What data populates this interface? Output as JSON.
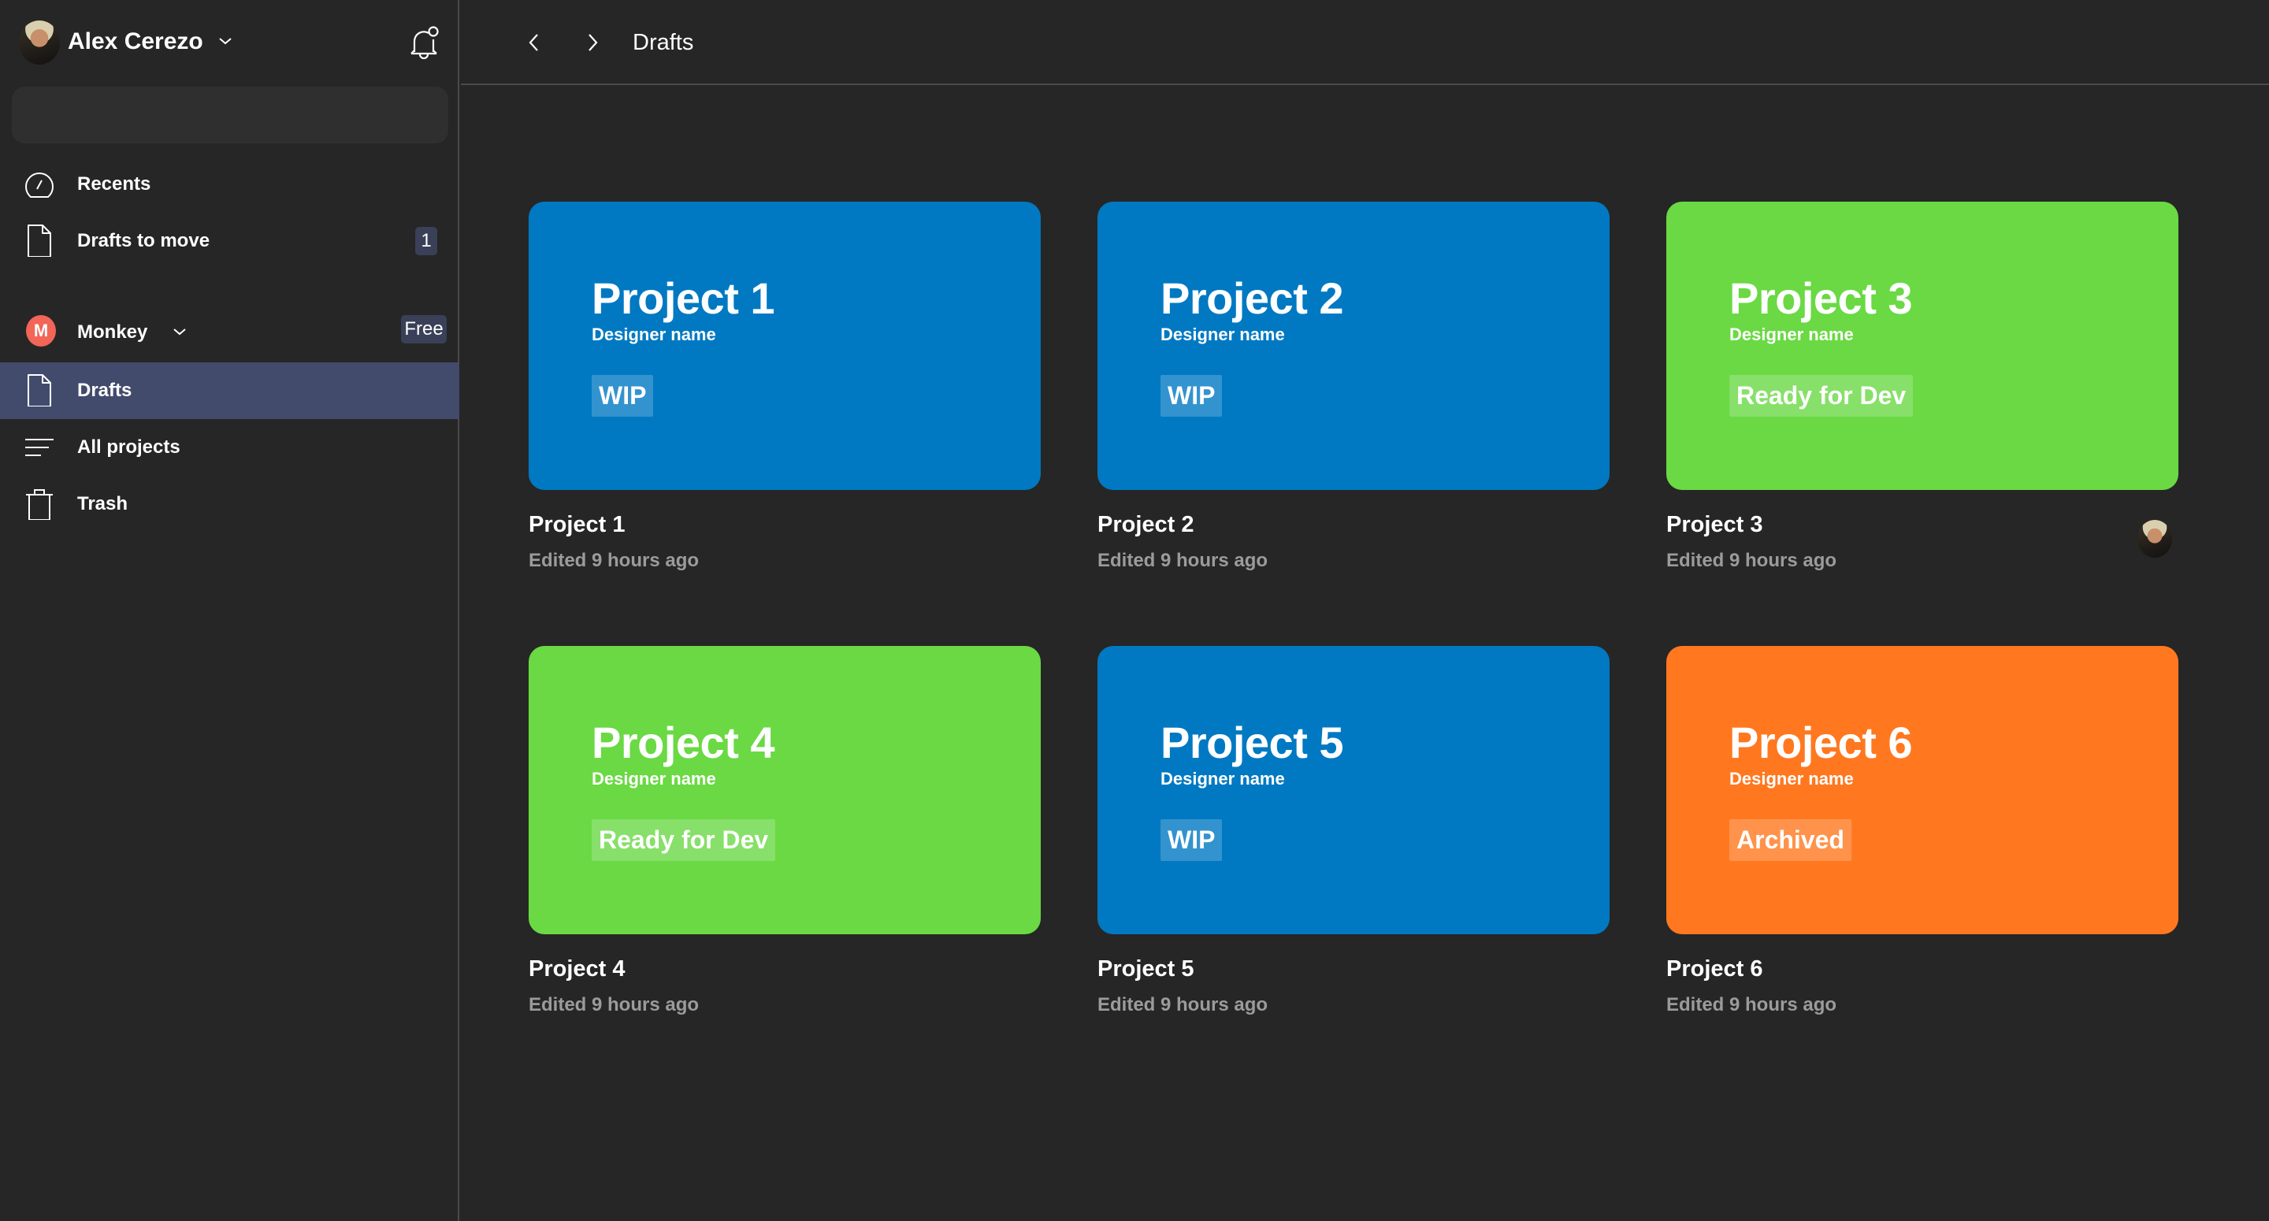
{
  "user": {
    "name": "Alex Cerezo",
    "avatar_icon": "user-avatar"
  },
  "sidebar": {
    "search": {
      "value": "",
      "placeholder": ""
    },
    "items": [
      {
        "label": "Recents",
        "icon": "recents-gauge-icon"
      },
      {
        "label": "Drafts to move",
        "icon": "file-icon",
        "count": "1"
      }
    ],
    "team": {
      "initial": "M",
      "name": "Monkey",
      "plan": "Free",
      "color": "#f26557"
    },
    "team_items": [
      {
        "label": "Drafts",
        "icon": "file-icon",
        "selected": true
      },
      {
        "label": "All projects",
        "icon": "list-icon"
      },
      {
        "label": "Trash",
        "icon": "trash-icon"
      }
    ]
  },
  "header": {
    "title": "Drafts",
    "back_icon": "chevron-left-icon",
    "forward_icon": "chevron-right-icon"
  },
  "projects": [
    {
      "title": "Project 1",
      "designer": "Designer name",
      "status": "WIP",
      "name": "Project 1",
      "edited": "Edited 9 hours ago",
      "color": "#0079c2",
      "has_avatar": false
    },
    {
      "title": "Project 2",
      "designer": "Designer name",
      "status": "WIP",
      "name": "Project 2",
      "edited": "Edited 9 hours ago",
      "color": "#0079c2",
      "has_avatar": false
    },
    {
      "title": "Project 3",
      "designer": "Designer name",
      "status": "Ready for Dev",
      "name": "Project 3",
      "edited": "Edited 9 hours ago",
      "color": "#6ad944",
      "has_avatar": true
    },
    {
      "title": "Project 4",
      "designer": "Designer name",
      "status": "Ready for Dev",
      "name": "Project 4",
      "edited": "Edited 9 hours ago",
      "color": "#6ad944",
      "has_avatar": false
    },
    {
      "title": "Project 5",
      "designer": "Designer name",
      "status": "WIP",
      "name": "Project 5",
      "edited": "Edited 9 hours ago",
      "color": "#0079c2",
      "has_avatar": false
    },
    {
      "title": "Project 6",
      "designer": "Designer name",
      "status": "Archived",
      "name": "Project 6",
      "edited": "Edited 9 hours ago",
      "color": "#ff7820",
      "has_avatar": false
    }
  ]
}
